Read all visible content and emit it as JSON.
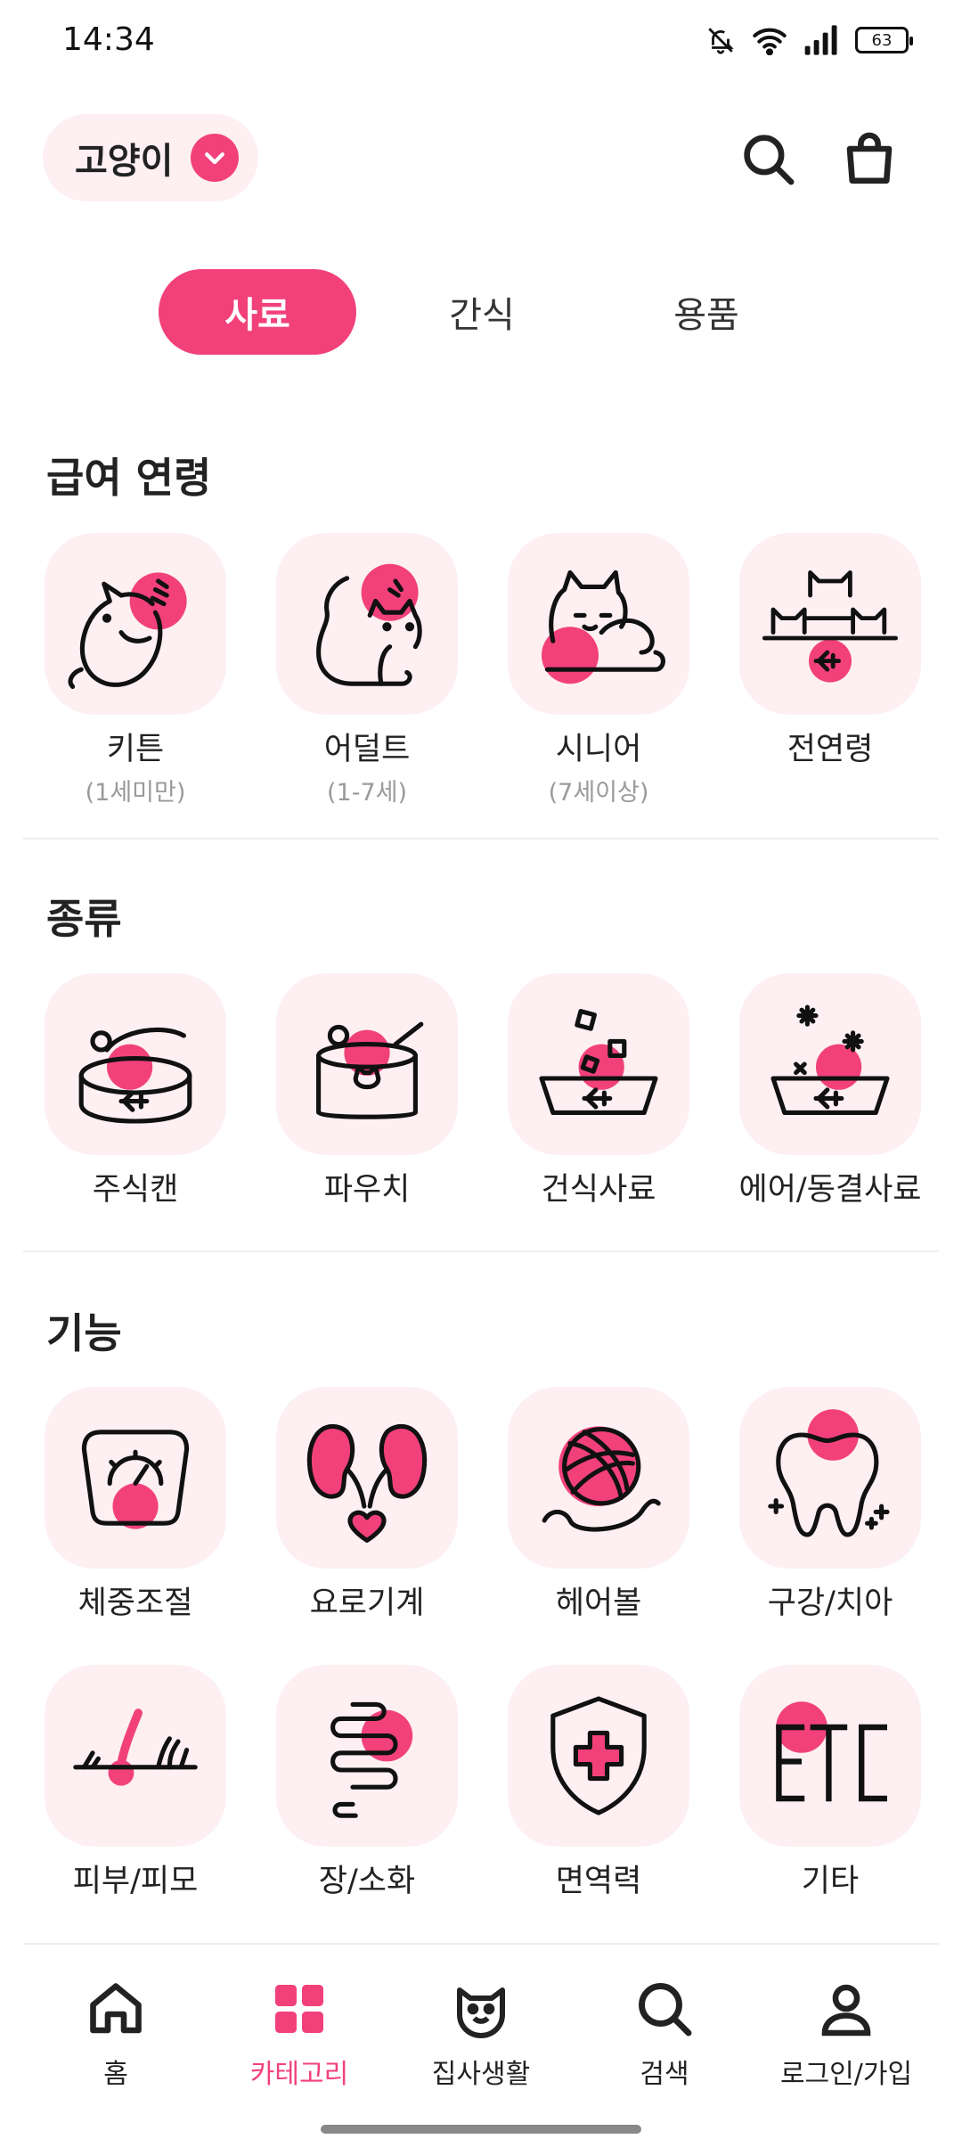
{
  "status": {
    "time": "14:34",
    "battery": "63"
  },
  "header": {
    "pet_selector": "고양이"
  },
  "tabs": [
    {
      "label": "사료",
      "active": true
    },
    {
      "label": "간식",
      "active": false
    },
    {
      "label": "용품",
      "active": false
    }
  ],
  "sections": {
    "age": {
      "title": "급여 연령",
      "items": [
        {
          "label": "키튼",
          "sub": "(1세미만)",
          "icon": "kitten-icon"
        },
        {
          "label": "어덜트",
          "sub": "(1-7세)",
          "icon": "adult-cat-icon"
        },
        {
          "label": "시니어",
          "sub": "(7세이상)",
          "icon": "senior-cat-icon"
        },
        {
          "label": "전연령",
          "sub": "",
          "icon": "all-ages-icon"
        }
      ]
    },
    "type": {
      "title": "종류",
      "items": [
        {
          "label": "주식캔",
          "icon": "can-icon"
        },
        {
          "label": "파우치",
          "icon": "pouch-icon"
        },
        {
          "label": "건식사료",
          "icon": "dry-food-bowl-icon"
        },
        {
          "label": "에어/동결사료",
          "icon": "freeze-dried-bowl-icon"
        }
      ]
    },
    "function": {
      "title": "기능",
      "items": [
        {
          "label": "체중조절",
          "icon": "scale-icon"
        },
        {
          "label": "요로기계",
          "icon": "kidney-icon"
        },
        {
          "label": "헤어볼",
          "icon": "yarn-ball-icon"
        },
        {
          "label": "구강/치아",
          "icon": "tooth-icon"
        },
        {
          "label": "피부/피모",
          "icon": "skin-hair-icon"
        },
        {
          "label": "장/소화",
          "icon": "intestine-icon"
        },
        {
          "label": "면역력",
          "icon": "shield-icon"
        },
        {
          "label": "기타",
          "icon": "etc-icon"
        }
      ]
    }
  },
  "bottom_nav": [
    {
      "label": "홈",
      "icon": "home-icon",
      "active": false
    },
    {
      "label": "카테고리",
      "icon": "category-grid-icon",
      "active": true
    },
    {
      "label": "집사생활",
      "icon": "cat-face-icon",
      "active": false
    },
    {
      "label": "검색",
      "icon": "search-icon",
      "active": false
    },
    {
      "label": "로그인/가입",
      "icon": "person-icon",
      "active": false
    }
  ],
  "colors": {
    "accent": "#f2417a",
    "tile_bg": "#fdeff2",
    "sub_text": "#9a9a9a"
  }
}
